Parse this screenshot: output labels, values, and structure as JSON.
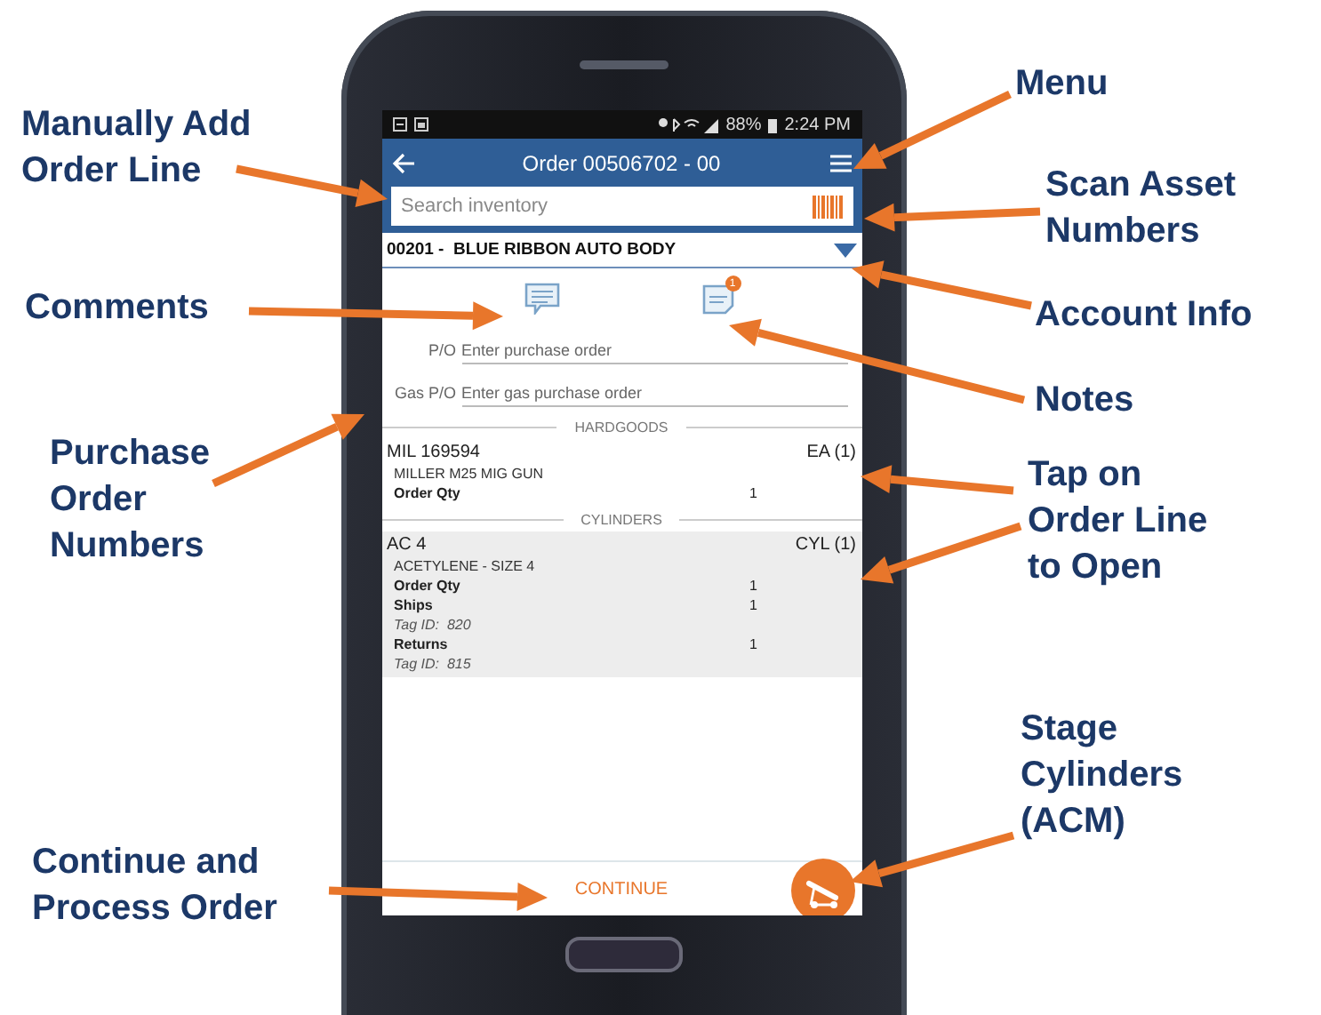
{
  "callouts": [
    {
      "lines": [
        "Menu"
      ]
    },
    {
      "lines": [
        "Manually Add",
        "Order Line"
      ]
    },
    {
      "lines": [
        "Scan Asset",
        "Numbers"
      ]
    },
    {
      "lines": [
        "Comments"
      ]
    },
    {
      "lines": [
        "Account Info"
      ]
    },
    {
      "lines": [
        "Notes"
      ]
    },
    {
      "lines": [
        "Purchase",
        "Order",
        "Numbers"
      ]
    },
    {
      "lines": [
        "Tap on",
        "Order Line",
        "to Open"
      ]
    },
    {
      "lines": [
        "Stage",
        "Cylinders",
        "(ACM)"
      ]
    },
    {
      "lines": [
        "Continue and",
        "Process Order"
      ]
    }
  ],
  "status_bar": {
    "battery": "88%",
    "time": "2:24 PM"
  },
  "app_bar": {
    "title": "Order 00506702 - 00"
  },
  "search": {
    "placeholder": "Search inventory"
  },
  "account": {
    "label": "00201 -  BLUE RIBBON AUTO BODY"
  },
  "notes_badge": "1",
  "po_fields": [
    {
      "label": "P/O",
      "placeholder": "Enter purchase order"
    },
    {
      "label": "Gas P/O",
      "placeholder": "Enter gas purchase order"
    }
  ],
  "sections": [
    {
      "title": "HARDGOODS",
      "lines": [
        {
          "code": "MIL 169594",
          "unit": "EA (1)",
          "description": "MILLER M25 MIG GUN",
          "highlighted": false,
          "details": [
            {
              "kind": "qty",
              "label": "Order Qty",
              "value": "1"
            }
          ]
        }
      ]
    },
    {
      "title": "CYLINDERS",
      "lines": [
        {
          "code": "AC 4",
          "unit": "CYL (1)",
          "description": "ACETYLENE - SIZE 4",
          "highlighted": true,
          "details": [
            {
              "kind": "qty",
              "label": "Order Qty",
              "value": "1"
            },
            {
              "kind": "qty",
              "label": "Ships",
              "value": "1"
            },
            {
              "kind": "tag",
              "label": "Tag ID:",
              "value": "820"
            },
            {
              "kind": "qty",
              "label": "Returns",
              "value": "1"
            },
            {
              "kind": "tag",
              "label": "Tag ID:",
              "value": "815"
            }
          ]
        }
      ]
    }
  ],
  "footer": {
    "button": "CONTINUE"
  }
}
